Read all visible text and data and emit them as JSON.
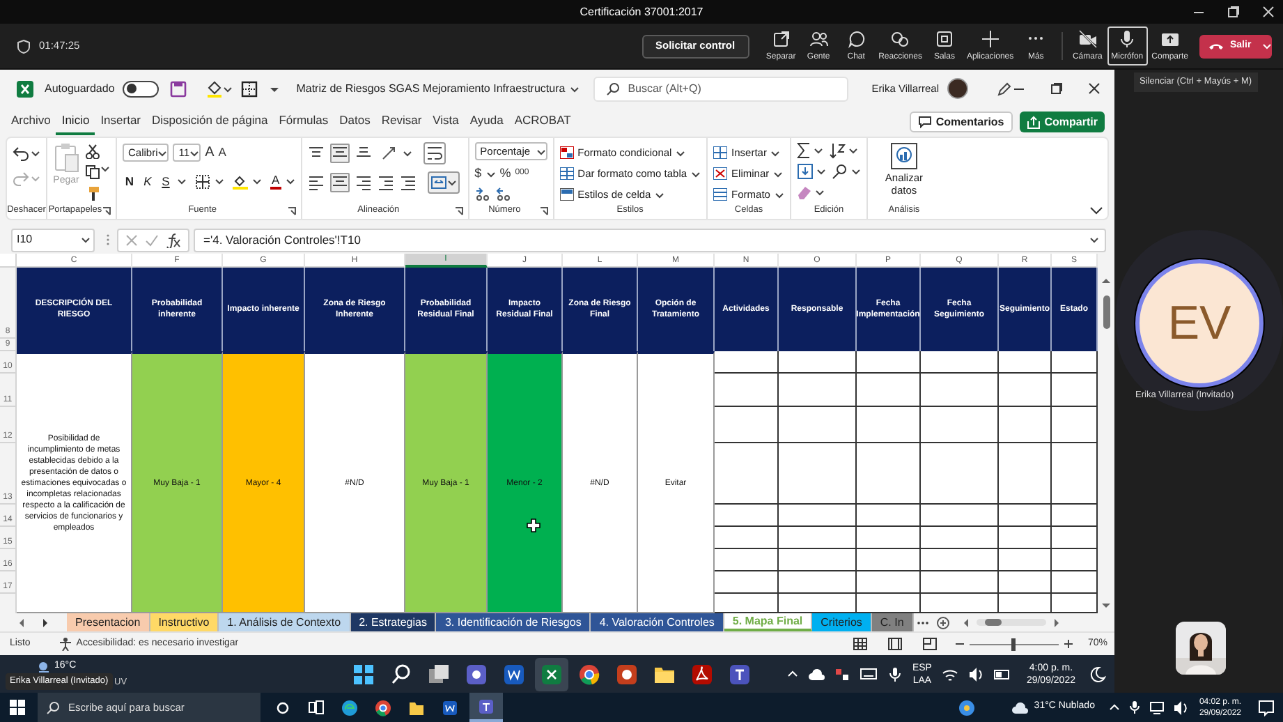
{
  "meeting": {
    "title": "Certificación 37001:2017",
    "timer": "01:47:25",
    "request_control": "Solicitar control",
    "actions": [
      {
        "label": "Separar",
        "hovered": false
      },
      {
        "label": "Gente",
        "hovered": false
      },
      {
        "label": "Chat",
        "hovered": false
      },
      {
        "label": "Reacciones",
        "hovered": false
      },
      {
        "label": "Salas",
        "hovered": false
      },
      {
        "label": "Aplicaciones",
        "hovered": false
      },
      {
        "label": "Más",
        "hovered": false
      },
      {
        "label": "Cámara",
        "hovered": false
      },
      {
        "label": "Micrófon",
        "hovered": true
      },
      {
        "label": "Comparte",
        "hovered": false
      }
    ],
    "leave": "Salir",
    "tooltip": "Silenciar (Ctrl + Mayús + M)"
  },
  "excel": {
    "autosave_label": "Autoguardado",
    "autosave_on": false,
    "document_title": "Matriz de Riesgos SGAS Mejoramiento Infraestructura",
    "search_placeholder": "Buscar (Alt+Q)",
    "user": "Erika Villarreal",
    "menu_tabs": [
      {
        "label": "Archivo",
        "selected": false
      },
      {
        "label": "Inicio",
        "selected": true
      },
      {
        "label": "Insertar",
        "selected": false
      },
      {
        "label": "Disposición de página",
        "selected": false
      },
      {
        "label": "Fórmulas",
        "selected": false
      },
      {
        "label": "Datos",
        "selected": false
      },
      {
        "label": "Revisar",
        "selected": false
      },
      {
        "label": "Vista",
        "selected": false
      },
      {
        "label": "Ayuda",
        "selected": false
      },
      {
        "label": "ACROBAT",
        "selected": false
      }
    ],
    "comments_button": "Comentarios",
    "share_button": "Compartir",
    "ribbon": {
      "undo_label": "Deshacer",
      "paste": "Pegar",
      "clipboard_label": "Portapapeles",
      "font_name": "Calibri",
      "font_size": "11",
      "grow": "A",
      "shrink": "A",
      "bold": "N",
      "italic": "K",
      "underline": "S",
      "font_color": "A",
      "font_label": "Fuente",
      "alignment_label": "Alineación",
      "number_format": "Porcentaje",
      "currency": "$",
      "percent": "%",
      "thousands": "000",
      "number_label": "Número",
      "style_commands": [
        "Formato condicional",
        "Dar formato como tabla",
        "Estilos de celda"
      ],
      "styles_label": "Estilos",
      "cell_commands": [
        "Insertar",
        "Eliminar",
        "Formato"
      ],
      "cells_label": "Celdas",
      "editing_label": "Edición",
      "analyze": "Analizar datos",
      "analysis_label": "Análisis"
    },
    "name_box": "I10",
    "formula": "='4. Valoración Controles'!T10",
    "columns": [
      {
        "letter": "C",
        "selected": false
      },
      {
        "letter": "F",
        "selected": false
      },
      {
        "letter": "G",
        "selected": false
      },
      {
        "letter": "H",
        "selected": false
      },
      {
        "letter": "I",
        "selected": true
      },
      {
        "letter": "J",
        "selected": false
      },
      {
        "letter": "L",
        "selected": false
      },
      {
        "letter": "M",
        "selected": false
      },
      {
        "letter": "N",
        "selected": false
      },
      {
        "letter": "O",
        "selected": false
      },
      {
        "letter": "P",
        "selected": false
      },
      {
        "letter": "Q",
        "selected": false
      },
      {
        "letter": "R",
        "selected": false
      },
      {
        "letter": "S",
        "selected": false
      }
    ],
    "rows": [
      "8",
      "9",
      "10",
      "11",
      "12",
      "13",
      "14",
      "15",
      "16",
      "17"
    ],
    "header_cells": [
      "DESCRIPCIÓN DEL RIESGO",
      "Probabilidad inherente",
      "Impacto inherente",
      "Zona de Riesgo Inherente",
      "Probabilidad Residual Final",
      "Impacto Residual Final",
      "Zona de Riesgo Final",
      "Opción de Tratamiento",
      "Actividades",
      "Responsable",
      "Fecha Implementación",
      "Fecha Seguimiento",
      "Seguimiento",
      "Estado"
    ],
    "risk_row": [
      {
        "text": "Posibilidad de incumplimiento de metas establecidas debido a la  presentación de datos o estimaciones equivocadas o incompletas relacionadas respecto a la calificación de servicios de funcionarios y empleados",
        "color": "#ffffff"
      },
      {
        "text": "Muy Baja - 1",
        "color": "#92d050"
      },
      {
        "text": "Mayor - 4",
        "color": "#ffc000"
      },
      {
        "text": "#N/D",
        "color": "#ffffff"
      },
      {
        "text": "Muy Baja - 1",
        "color": "#92d050"
      },
      {
        "text": "Menor - 2",
        "color": "#00b050"
      },
      {
        "text": "#N/D",
        "color": "#ffffff"
      },
      {
        "text": "Evitar",
        "color": "#ffffff"
      }
    ],
    "sheet_tabs": [
      {
        "label": "Presentacion",
        "color": "#f8cbad",
        "selected": false
      },
      {
        "label": "Instructivo",
        "color": "#ffd966",
        "selected": false
      },
      {
        "label": "1. Análisis de Contexto",
        "color": "#bdd7ee",
        "selected": false
      },
      {
        "label": "2. Estrategias",
        "color": "#1f3864",
        "selected": false
      },
      {
        "label": "3. Identificación de Riesgos",
        "color": "#2f5597",
        "selected": false
      },
      {
        "label": "4. Valoración Controles",
        "color": "#2f5597",
        "selected": false
      },
      {
        "label": "5. Mapa Final",
        "color": "#70ad47",
        "selected": true
      },
      {
        "label": "Criterios",
        "color": "#00b0f0",
        "selected": false
      },
      {
        "label": "C. In",
        "color": "#808080",
        "selected": false
      }
    ],
    "status": {
      "ready": "Listo",
      "accessibility": "Accesibilidad: es necesario investigar",
      "zoom": "70%",
      "zoom_slider": {
        "level": 0.5
      }
    }
  },
  "participant": {
    "initials": "EV",
    "name": "Erika Villarreal (Invitado)"
  },
  "shared_taskbar": {
    "temperature": "16°C",
    "weather_detail": "UV",
    "presenter_label": "Erika Villarreal (Invitado)",
    "language": "ESP",
    "layout": "LAA",
    "time": "4:00 p. m.",
    "date": "29/09/2022"
  },
  "taskbar": {
    "search_placeholder": "Escribe aquí para buscar",
    "weather": "31°C Nublado",
    "time": "04:02 p. m.",
    "date": "29/09/2022"
  }
}
